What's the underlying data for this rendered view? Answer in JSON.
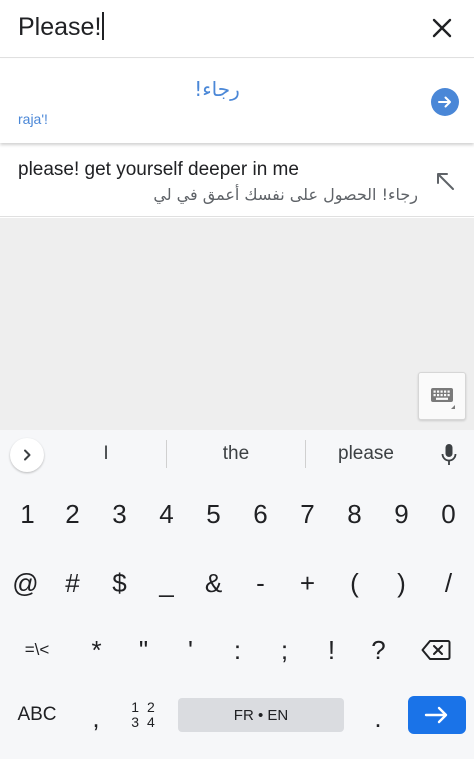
{
  "search": {
    "query": "Please!"
  },
  "result": {
    "arabic": "رجاء!",
    "transliteration": "raja'!"
  },
  "suggestion": {
    "english": "please! get yourself deeper in me",
    "arabic": "رجاء! الحصول على نفسك أعمق في لي"
  },
  "keyboard": {
    "suggestions": [
      "I",
      "the",
      "please"
    ],
    "row1": [
      "1",
      "2",
      "3",
      "4",
      "5",
      "6",
      "7",
      "8",
      "9",
      "0"
    ],
    "row2": [
      "@",
      "#",
      "$",
      "_",
      "&",
      "-",
      "+",
      "(",
      ")",
      "/"
    ],
    "row3": [
      "=\\<",
      "*",
      "\"",
      "'",
      ":",
      ";",
      "!",
      "?"
    ],
    "row4": {
      "abc": "ABC",
      "comma": ",",
      "num_top": "1 2",
      "num_bottom": "3 4",
      "space": "FR • EN",
      "period": "."
    }
  },
  "colors": {
    "accent": "#4a87d7",
    "enter": "#1a73e8",
    "empty_area": "#eeeeee"
  },
  "icons": [
    "close-icon",
    "arrow-right-icon",
    "arrow-up-left-icon",
    "keyboard-icon",
    "chevron-right-icon",
    "mic-icon",
    "backspace-icon"
  ]
}
